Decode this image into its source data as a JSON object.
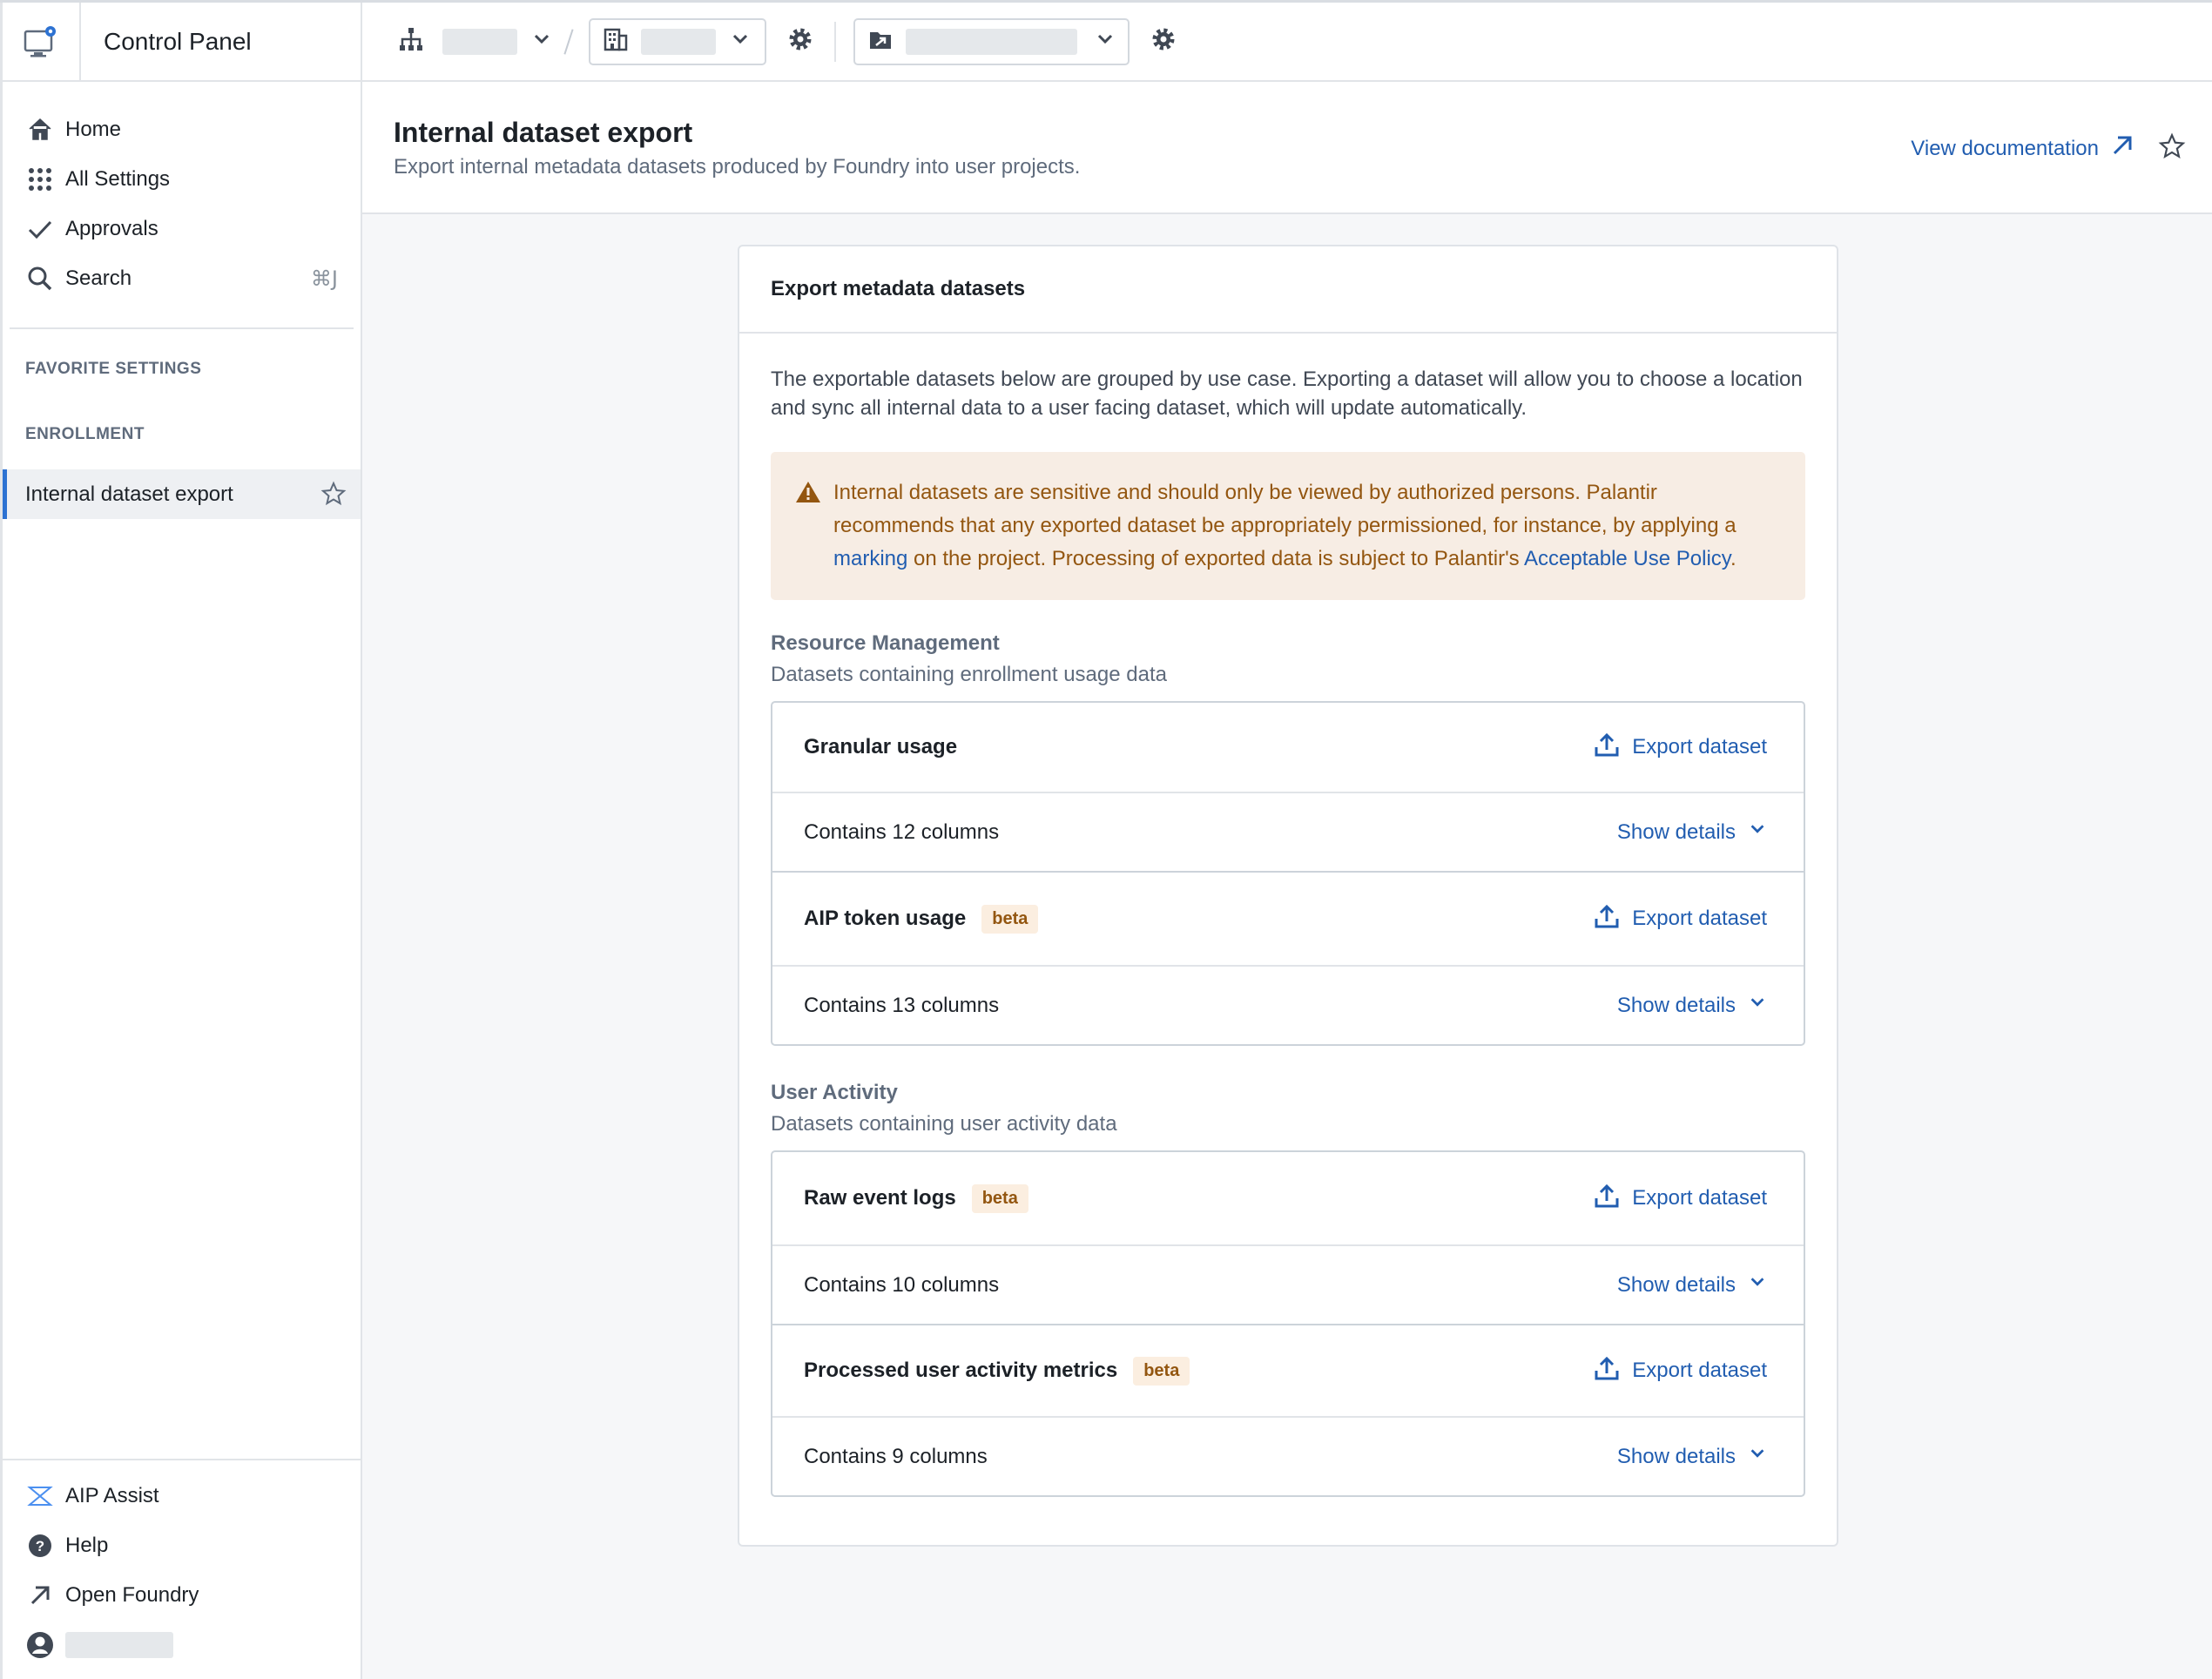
{
  "app": {
    "title": "Control Panel"
  },
  "sidebar": {
    "nav": [
      {
        "label": "Home",
        "icon": "home-icon"
      },
      {
        "label": "All Settings",
        "icon": "grid-icon"
      },
      {
        "label": "Approvals",
        "icon": "check-icon"
      },
      {
        "label": "Search",
        "icon": "search-icon",
        "shortcut": "⌘J"
      }
    ],
    "favorite_label": "FAVORITE SETTINGS",
    "enrollment_label": "ENROLLMENT",
    "active_item": "Internal dataset export",
    "bottom": [
      {
        "label": "AIP Assist",
        "icon": "aip-assist-icon"
      },
      {
        "label": "Help",
        "icon": "help-icon"
      },
      {
        "label": "Open Foundry",
        "icon": "arrow-up-right-icon"
      }
    ]
  },
  "header": {
    "title": "Internal dataset export",
    "subtitle": "Export internal metadata datasets produced by Foundry into user projects.",
    "doc_link": "View documentation"
  },
  "card": {
    "title": "Export metadata datasets",
    "intro": "The exportable datasets below are grouped by use case. Exporting a dataset will allow you to choose a location and sync all internal data to a user facing dataset, which will update automatically.",
    "warning": {
      "part1": "Internal datasets are sensitive and should only be viewed by authorized persons. Palantir recommends that any exported dataset be appropriately permissioned, for instance, by applying a ",
      "link1": "marking",
      "part2": " on the project. Processing of exported data is subject to Palantir's ",
      "link2": "Acceptable Use Policy",
      "part3": "."
    },
    "export_label": "Export dataset",
    "details_label": "Show details",
    "groups": [
      {
        "title": "Resource Management",
        "subtitle": "Datasets containing enrollment usage data",
        "datasets": [
          {
            "name": "Granular usage",
            "badge": "",
            "columns": "Contains 12 columns"
          },
          {
            "name": "AIP token usage",
            "badge": "beta",
            "columns": "Contains 13 columns"
          }
        ]
      },
      {
        "title": "User Activity",
        "subtitle": "Datasets containing user activity data",
        "datasets": [
          {
            "name": "Raw event logs",
            "badge": "beta",
            "columns": "Contains 10 columns"
          },
          {
            "name": "Processed user activity metrics",
            "badge": "beta",
            "columns": "Contains 9 columns"
          }
        ]
      }
    ]
  },
  "colors": {
    "accent": "#2d72d2",
    "link": "#215db0",
    "warning_text": "#935610",
    "warning_bg": "#f7ede4"
  }
}
